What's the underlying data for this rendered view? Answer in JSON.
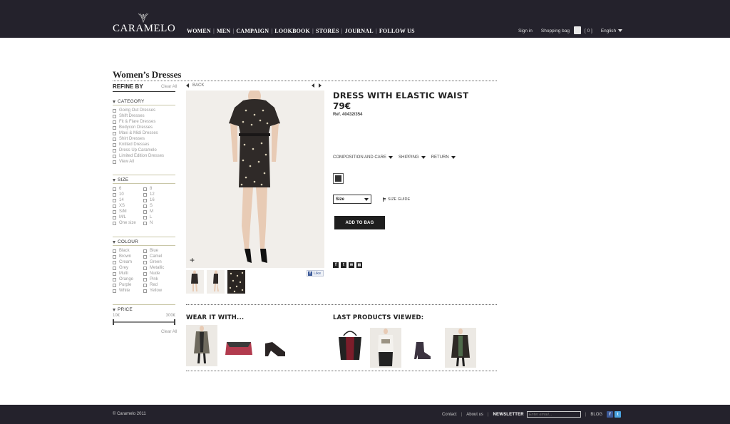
{
  "brand": {
    "name": "CARAMELO"
  },
  "nav": {
    "items": [
      "WOMEN",
      "MEN",
      "CAMPAIGN",
      "LOOKBOOK",
      "STORES",
      "JOURNAL",
      "FOLLOW US"
    ],
    "separator": "|"
  },
  "util": {
    "signin": "Sign in",
    "bag_label": "Shopping bag",
    "bag_count": "[ 0 ]",
    "language": "English"
  },
  "page": {
    "title": "Women’s Dresses"
  },
  "sidebar": {
    "refine_label": "REFINE BY",
    "clear_all": "Clear All",
    "category": {
      "label": "CATEGORY",
      "items": [
        "Going Out Dresses",
        "Shift Dresses",
        "Fit & Flare Dresses",
        "Bodycon Dresses",
        "Maxi & Midi Dresses",
        "Shirt Dresses",
        "Knitted Dresses",
        "Dress Up Caramelo",
        "Limited Edition Dresses",
        "View All"
      ]
    },
    "size": {
      "label": "SIZE",
      "col1": [
        "6",
        "10",
        "14",
        "XS",
        "S/M",
        "M/L",
        "One size"
      ],
      "col2": [
        "8",
        "12",
        "16",
        "S",
        "M",
        "L",
        "N"
      ]
    },
    "colour": {
      "label": "COLOUR",
      "col1": [
        "Black",
        "Brown",
        "Cream",
        "Grey",
        "Multi",
        "Orange",
        "Purple",
        "White"
      ],
      "col2": [
        "Blue",
        "Camel",
        "Green",
        "Metallic",
        "Nude",
        "Pink",
        "Red",
        "Yellow"
      ]
    },
    "price": {
      "label": "PRICE",
      "min": "10€",
      "max": "300€",
      "range": [
        0,
        1
      ]
    }
  },
  "product": {
    "back_label": "BACK",
    "zoom_symbol": "+",
    "like_label": "Like",
    "title": "DRESS WITH ELASTIC WAIST",
    "price": "79€",
    "ref": "Ref. 40432/354",
    "detail_links": [
      "COMPOSITION AND CARE",
      "SHIPPING",
      "RETURN"
    ],
    "colour_swatch": "#333333",
    "size_placeholder": "Size",
    "size_guide": "SIZE GUIDE",
    "add_to_bag": "ADD TO BAG"
  },
  "wear_it_with": {
    "title": "WEAR IT WITH..."
  },
  "last_viewed": {
    "title": "LAST PRODUCTS VIEWED:"
  },
  "footer": {
    "copyright": "© Caramelo 2011",
    "contact": "Contact",
    "about": "About us",
    "newsletter_label": "NEWSLETTER",
    "newsletter_placeholder": "Enter email...",
    "blog": "BLOG"
  },
  "colors": {
    "header_bg": "#24222c",
    "filter_rule": "#c9c7a8",
    "button_bg": "#1e1e1e",
    "facebook": "#3b5998",
    "twitter": "#4aa3df"
  }
}
